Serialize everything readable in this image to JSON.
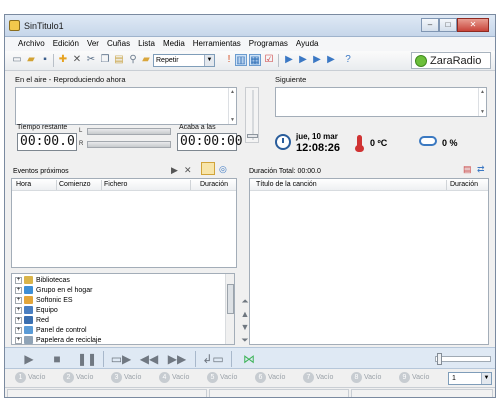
{
  "window": {
    "title": "SinTitulo1"
  },
  "menu": [
    "Archivo",
    "Edición",
    "Ver",
    "Cuñas",
    "Lista",
    "Media",
    "Herramientas",
    "Programas",
    "Ayuda"
  ],
  "toolbar": {
    "repeat_mode": "Repetir",
    "logo_text": "ZaraRadio"
  },
  "on_air": {
    "label": "En el aire - Reproduciendo ahora"
  },
  "next": {
    "label": "Siguiente"
  },
  "timer": {
    "remaining_label": "Tiempo restante",
    "remaining_value": "00:00.0",
    "ends_label": "Acaba a las",
    "ends_value": "00:00:00",
    "meter_left": "L",
    "meter_right": "R"
  },
  "clock": {
    "date": "jue, 10 mar",
    "time": "12:08:26"
  },
  "weather": {
    "temperature": "0 ºC",
    "humidity": "0 %"
  },
  "events": {
    "label": "Eventos próximos",
    "columns": [
      "Hora",
      "Comienzo",
      "Fichero",
      "Duración"
    ]
  },
  "playlist": {
    "total_label": "Duración Total: 00:00.0",
    "columns": [
      "Título de la canción",
      "Duración"
    ]
  },
  "tree": [
    {
      "label": "Bibliotecas",
      "icon": "library-icon",
      "color": "#d9b44a"
    },
    {
      "label": "Grupo en el hogar",
      "icon": "homegroup-icon",
      "color": "#3e8fd6"
    },
    {
      "label": "Softonic ES",
      "icon": "user-folder-icon",
      "color": "#e3a63a"
    },
    {
      "label": "Equipo",
      "icon": "computer-icon",
      "color": "#4a7fc1"
    },
    {
      "label": "Red",
      "icon": "network-icon",
      "color": "#3a6fb0"
    },
    {
      "label": "Panel de control",
      "icon": "control-panel-icon",
      "color": "#5a9bd6"
    },
    {
      "label": "Papelera de reciclaje",
      "icon": "recycle-bin-icon",
      "color": "#8fa3b6"
    }
  ],
  "slots": [
    {
      "num": "1",
      "label": "Vacío"
    },
    {
      "num": "2",
      "label": "Vacío"
    },
    {
      "num": "3",
      "label": "Vacío"
    },
    {
      "num": "4",
      "label": "Vacío"
    },
    {
      "num": "5",
      "label": "Vacío"
    },
    {
      "num": "6",
      "label": "Vacío"
    },
    {
      "num": "7",
      "label": "Vacío"
    },
    {
      "num": "8",
      "label": "Vacío"
    },
    {
      "num": "9",
      "label": "Vacío"
    }
  ],
  "page_select": {
    "value": "1"
  }
}
